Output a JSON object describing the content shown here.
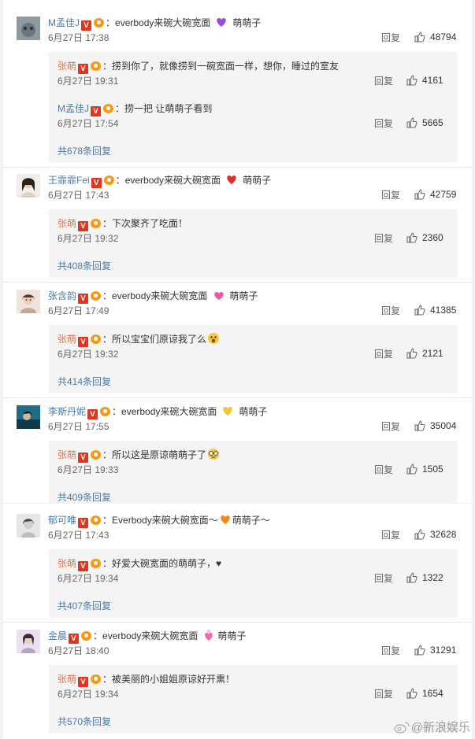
{
  "reply_label": "回复",
  "colors": {
    "name": "#eb7350",
    "link": "#4a7aa8",
    "badge": "#e8331c"
  },
  "comments": [
    {
      "name": "M孟佳J",
      "text": "everbody来碗大碗宽面",
      "emoji": "purple-heart",
      "tail": "萌萌子",
      "time": "6月27日 17:38",
      "likes": "48794",
      "replies": [
        {
          "name": "张萌",
          "text": "捞到你了，就像捞到一碗宽面一样，想你，睡过的室友",
          "time": "6月27日 19:31",
          "likes": "4161"
        },
        {
          "name": "M孟佳J",
          "text": "捞一把 让萌萌子看到",
          "time": "6月27日 17:54",
          "likes": "5665"
        }
      ],
      "more": "共678条回复"
    },
    {
      "name": "王霏霏Fei",
      "text": "everbody来碗大碗宽面",
      "emoji": "red-heart",
      "tail": "萌萌子",
      "time": "6月27日 17:43",
      "likes": "42759",
      "replies": [
        {
          "name": "张萌",
          "text": "下次聚齐了吃面！",
          "time": "6月27日 19:32",
          "likes": "2360"
        }
      ],
      "more": "共408条回复"
    },
    {
      "name": "张含韵",
      "text": "everbody来碗大碗宽面",
      "emoji": "sparkling-heart",
      "tail": "萌萌子",
      "time": "6月27日 17:49",
      "likes": "41385",
      "replies": [
        {
          "name": "张萌",
          "text": "所以宝宝们原谅我了么",
          "time": "6月27日 19:32",
          "likes": "2121"
        }
      ],
      "more": "共414条回复"
    },
    {
      "name": "李斯丹妮",
      "text": "everbody来碗大碗宽面",
      "emoji": "yellow-heart",
      "tail": "萌萌子",
      "time": "6月27日 17:55",
      "likes": "35004",
      "replies": [
        {
          "name": "张萌",
          "text": "所以这是原谅萌萌子了",
          "time": "6月27日 19:33",
          "likes": "1505"
        }
      ],
      "more": "共409条回复"
    },
    {
      "name": "郁可唯",
      "text": "Everbody来碗大碗宽面～",
      "emoji": "orange-heart",
      "tail": "萌萌子～",
      "time": "6月27日 17:43",
      "likes": "32628",
      "replies": [
        {
          "name": "张萌",
          "text": "好爱大碗宽面的萌萌子，♥",
          "time": "6月27日 19:34",
          "likes": "1322"
        }
      ],
      "more": "共407条回复"
    },
    {
      "name": "金晨",
      "text": "everbody来碗大碗宽面",
      "emoji": "pink-heart",
      "tail": "萌萌子",
      "time": "6月27日 18:40",
      "likes": "31291",
      "replies": [
        {
          "name": "张萌",
          "text": "被美丽的小姐姐原谅好开熏！",
          "time": "6月27日 19:34",
          "likes": "1654"
        }
      ],
      "more": "共570条回复"
    }
  ],
  "watermark": "@新浪娱乐"
}
